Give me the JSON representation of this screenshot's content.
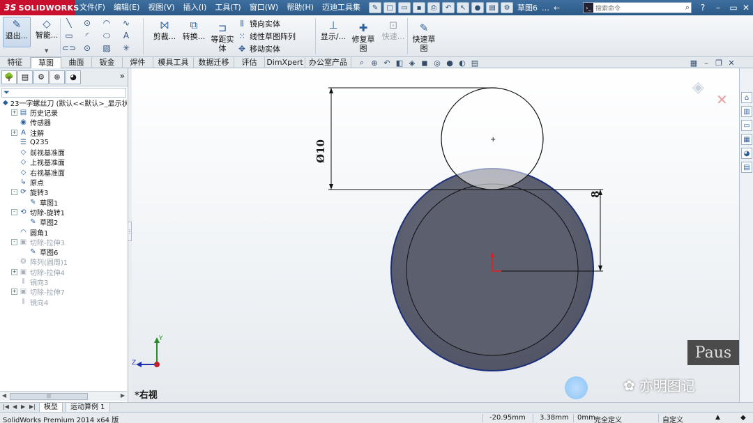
{
  "app": {
    "logo_text": "SOLIDWORKS",
    "logo_prefix": "3S",
    "document_name": "草图6",
    "search_placeholder": "搜索命令"
  },
  "menu": [
    "文件(F)",
    "编辑(E)",
    "视图(V)",
    "插入(I)",
    "工具(T)",
    "窗口(W)",
    "帮助(H)",
    "迈迪工具集"
  ],
  "ribbon": {
    "exit_sketch": "退出...",
    "smart_dim": "智能...",
    "trim": "剪裁...",
    "convert": "转换...",
    "offset_line1": "等距实",
    "offset_line2": "体",
    "mirror": "镜向实体",
    "linear_pattern": "线性草图阵列",
    "move": "移动实体",
    "display": "显示/...",
    "repair_line1": "修复草",
    "repair_line2": "图",
    "quick_snaps": "快速...",
    "quick_sketch_line1": "快速草",
    "quick_sketch_line2": "图"
  },
  "tabs": [
    "特征",
    "草图",
    "曲面",
    "钣金",
    "焊件",
    "模具工具",
    "数据迁移",
    "评估",
    "DimXpert",
    "办公室产品"
  ],
  "active_tab": "草图",
  "feature_tree": [
    {
      "label": "23一字螺丝刀 (默认<<默认>_显示状态",
      "icon": "part-icon",
      "exp": "",
      "indent": 0,
      "dim": false
    },
    {
      "label": "历史记录",
      "icon": "history-icon",
      "exp": "+",
      "indent": 1,
      "dim": false
    },
    {
      "label": "传感器",
      "icon": "sensor-icon",
      "exp": "",
      "indent": 1,
      "dim": false
    },
    {
      "label": "注解",
      "icon": "annotation-icon",
      "exp": "+",
      "indent": 1,
      "dim": false
    },
    {
      "label": "Q235",
      "icon": "material-icon",
      "exp": "",
      "indent": 1,
      "dim": false
    },
    {
      "label": "前视基准面",
      "icon": "plane-icon",
      "exp": "",
      "indent": 1,
      "dim": false
    },
    {
      "label": "上视基准面",
      "icon": "plane-icon",
      "exp": "",
      "indent": 1,
      "dim": false
    },
    {
      "label": "右视基准面",
      "icon": "plane-icon",
      "exp": "",
      "indent": 1,
      "dim": false
    },
    {
      "label": "原点",
      "icon": "origin-icon",
      "exp": "",
      "indent": 1,
      "dim": false
    },
    {
      "label": "旋转3",
      "icon": "revolve-icon",
      "exp": "-",
      "indent": 1,
      "dim": false
    },
    {
      "label": "草图1",
      "icon": "sketch-icon",
      "exp": "",
      "indent": 2,
      "dim": false
    },
    {
      "label": "切除-旋转1",
      "icon": "cut-revolve-icon",
      "exp": "-",
      "indent": 1,
      "dim": false
    },
    {
      "label": "草图2",
      "icon": "sketch-icon",
      "exp": "",
      "indent": 2,
      "dim": false
    },
    {
      "label": "圆角1",
      "icon": "fillet-icon",
      "exp": "",
      "indent": 1,
      "dim": false
    },
    {
      "label": "切除-拉伸3",
      "icon": "cut-extrude-icon",
      "exp": "-",
      "indent": 1,
      "dim": true
    },
    {
      "label": "草图6",
      "icon": "sketch-icon",
      "exp": "",
      "indent": 2,
      "dim": false
    },
    {
      "label": "阵列(圆周)1",
      "icon": "pattern-icon",
      "exp": "",
      "indent": 1,
      "dim": true
    },
    {
      "label": "切除-拉伸4",
      "icon": "cut-extrude-icon",
      "exp": "+",
      "indent": 1,
      "dim": true
    },
    {
      "label": "镜向3",
      "icon": "mirror-icon",
      "exp": "",
      "indent": 1,
      "dim": true
    },
    {
      "label": "切除-拉伸7",
      "icon": "cut-extrude-icon",
      "exp": "+",
      "indent": 1,
      "dim": true
    },
    {
      "label": "镜向4",
      "icon": "mirror-icon",
      "exp": "",
      "indent": 1,
      "dim": true
    }
  ],
  "bottom_tabs": [
    "模型",
    "运动算例 1"
  ],
  "viewport": {
    "view_name": "*右视",
    "dimension_diameter": "Ø10",
    "dimension_linear": "8",
    "triad_y": "Y",
    "triad_z": "Z",
    "pause_text": "Paus",
    "watermark_text": "亦明图记"
  },
  "status": {
    "product": "SolidWorks Premium 2014 x64 版",
    "x_coord": "-20.95mm",
    "y_coord": "3.38mm",
    "z_coord": "0mm",
    "definition": "完全定义",
    "mode": "自定义"
  },
  "colors": {
    "title_bar": "#2b5a88",
    "logo_red": "#c8102e",
    "body_fill": "#5b5f6e",
    "outline_blue": "#1a2e7a"
  }
}
